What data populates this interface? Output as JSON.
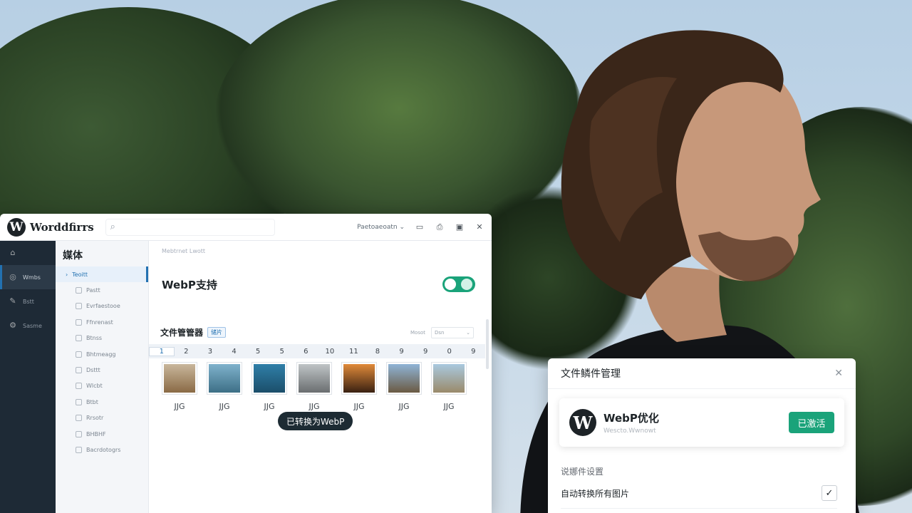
{
  "window": {
    "brand": "Worddfirrs",
    "search_icon": "search-icon",
    "toolbar_dropdown": "Paetoaeoatn",
    "toolbar_icons": [
      "file-icon",
      "printer-icon",
      "save-icon",
      "close-icon"
    ]
  },
  "adminbar": {
    "items": [
      {
        "label": "",
        "icon": "home-icon"
      },
      {
        "label": "Wmbs",
        "icon": "media-icon"
      },
      {
        "label": "Bstt",
        "icon": "edit-icon"
      },
      {
        "label": "Sasme",
        "icon": "settings-icon"
      }
    ]
  },
  "submenu": {
    "title": "媒体",
    "items": [
      "Teoitt",
      "Pastt",
      "Evrfaestooe",
      "Ffnrenast",
      "Btnss",
      "Bhtmeagg",
      "Dsttt",
      "Wlcbt",
      "Btbt",
      "Rrsotr",
      "BHBHF",
      "Bacrdotogrs"
    ]
  },
  "content": {
    "breadcrumb": "Mebtrnet Lwott",
    "webp_title": "WebP支持",
    "file_manager_title": "文件管管器",
    "file_manager_badge": "储片",
    "filter_label": "Mosot",
    "filter_value": "Dsn",
    "numbers": [
      "1",
      "2",
      "3",
      "4",
      "5",
      "5",
      "6",
      "10",
      "11",
      "8",
      "9",
      "9",
      "0",
      "9"
    ],
    "thumbnails": [
      {
        "label": "JJG",
        "colors": [
          "#c9b79c",
          "#8a6a45"
        ]
      },
      {
        "label": "JJG",
        "colors": [
          "#7fb2cc",
          "#3d6f86"
        ]
      },
      {
        "label": "JJG",
        "colors": [
          "#2f7fa8",
          "#1b4e6a"
        ]
      },
      {
        "label": "JJG",
        "colors": [
          "#bfc4c6",
          "#6a6e70"
        ]
      },
      {
        "label": "JJG",
        "colors": [
          "#e08a3a",
          "#3a2112"
        ]
      },
      {
        "label": "JJG",
        "colors": [
          "#8fb4d6",
          "#6b5a43"
        ]
      },
      {
        "label": "JJG",
        "colors": [
          "#a9c9df",
          "#9a8a6a"
        ]
      }
    ],
    "tooltip": "已转换为WebP"
  },
  "dialog": {
    "title": "文件鳞件管理",
    "plugin_name": "WebP优化",
    "plugin_sub": "Wescto.Wwnowt",
    "activated_label": "已激活",
    "section_label": "说娜件设置",
    "option_label": "自动转换所有图片",
    "option_checked": true
  },
  "colors": {
    "accent_green": "#1aa37a",
    "admin_dark": "#1e2a36",
    "wp_blue": "#2271b1"
  }
}
